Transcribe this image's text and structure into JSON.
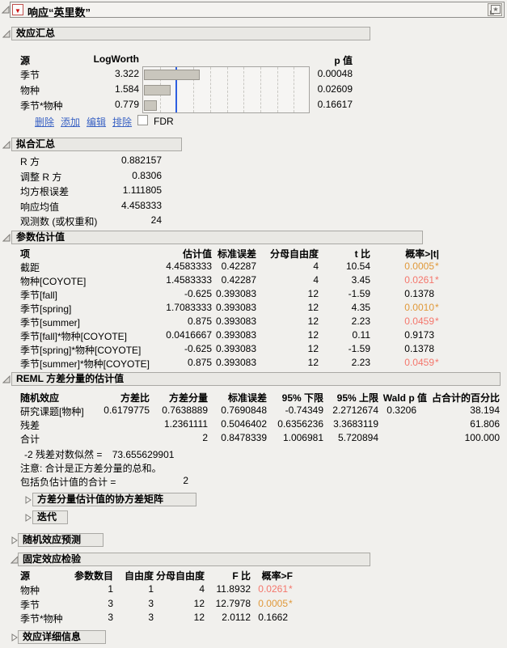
{
  "palette": {
    "sig_orange": "#e0993a",
    "sig_red": "#f4766c",
    "link_blue": "#3b63c4",
    "bar_fill": "#c9c6bd",
    "bar_border": "#9a978f",
    "reference_line_blue": "#2e5fe0",
    "section_header_bg": "#e9e8e4",
    "page_bg": "#f1f0ed"
  },
  "window": {
    "title": "响应“英里数”",
    "red_triangle_icon": "▼",
    "star_icon": "★"
  },
  "sections": {
    "effect_summary": "效应汇总",
    "fit_summary": "拟合汇总",
    "param_estimates": "参数估计值",
    "reml": "REML 方差分量的估计值",
    "cov_matrix": "方差分量估计值的协方差矩阵",
    "iterations": "迭代",
    "random_effect_pred": "随机效应预测",
    "fixed_effect_tests": "固定效应检验",
    "effect_details": "效应详细信息"
  },
  "chart_data": {
    "type": "bar",
    "orientation": "horizontal",
    "title": "效应汇总",
    "col_source": "源",
    "col_logworth": "LogWorth",
    "col_p": "p 值",
    "categories": [
      "季节",
      "物种",
      "季节*物种"
    ],
    "logworth": [
      3.322,
      1.584,
      0.779
    ],
    "logworth_labels": [
      "3.322",
      "1.584",
      "0.779"
    ],
    "p_values": [
      "0.00048",
      "0.02609",
      "0.16617"
    ],
    "xlim": [
      0,
      10
    ],
    "gridline_interval": 1,
    "reference_line": 2,
    "grid": "dashed-vertical"
  },
  "effect_summary": {
    "links": [
      "删除",
      "添加",
      "编辑",
      "排除"
    ],
    "fdr_label": "FDR",
    "fdr_checked": false
  },
  "fit_summary": {
    "rows": [
      [
        "R 方",
        "0.882157"
      ],
      [
        "调整 R 方",
        "0.8306"
      ],
      [
        "均方根误差",
        "1.111805"
      ],
      [
        "响应均值",
        "4.458333"
      ],
      [
        "观测数 (或权重和)",
        "24"
      ]
    ]
  },
  "param_estimates": {
    "columns": [
      "项",
      "估计值",
      "标准误差",
      "分母自由度",
      "t 比",
      "概率>|t|"
    ],
    "rows": [
      [
        "截距",
        "4.4583333",
        "0.42287",
        "4",
        "10.54",
        "0.0005*"
      ],
      [
        "物种[COYOTE]",
        "1.4583333",
        "0.42287",
        "4",
        "3.45",
        "0.0261*"
      ],
      [
        "季节[fall]",
        "-0.625",
        "0.393083",
        "12",
        "-1.59",
        "0.1378"
      ],
      [
        "季节[spring]",
        "1.7083333",
        "0.393083",
        "12",
        "4.35",
        "0.0010*"
      ],
      [
        "季节[summer]",
        "0.875",
        "0.393083",
        "12",
        "2.23",
        "0.0459*"
      ],
      [
        "季节[fall]*物种[COYOTE]",
        "0.0416667",
        "0.393083",
        "12",
        "0.11",
        "0.9173"
      ],
      [
        "季节[spring]*物种[COYOTE]",
        "-0.625",
        "0.393083",
        "12",
        "-1.59",
        "0.1378"
      ],
      [
        "季节[summer]*物种[COYOTE]",
        "0.875",
        "0.393083",
        "12",
        "2.23",
        "0.0459*"
      ]
    ],
    "cell_colors": {
      "0,5": "sig_orange",
      "1,5": "sig_red",
      "3,5": "sig_orange",
      "4,5": "sig_red",
      "7,5": "sig_red"
    }
  },
  "reml": {
    "columns": [
      "随机效应",
      "方差比",
      "方差分量",
      "标准误差",
      "95% 下限",
      "95% 上限",
      "Wald p 值",
      "占合计的百分比"
    ],
    "rows": [
      [
        "研究课题[物种]",
        "0.6179775",
        "0.7638889",
        "0.7690848",
        "-0.74349",
        "2.2712674",
        "0.3206",
        "38.194"
      ],
      [
        "残差",
        "",
        "1.2361111",
        "0.5046402",
        "0.6356236",
        "3.3683119",
        "",
        "61.806"
      ],
      [
        "合计",
        "",
        "2",
        "0.8478339",
        "1.006981",
        "5.720894",
        "",
        "100.000"
      ]
    ],
    "cell_colors": {},
    "neg2loglik_label": "-2 残差对数似然 =",
    "neg2loglik_value": "73.655629901",
    "note": "注意: 合计是正方差分量的总和。",
    "total_incl_label": "包括负估计值的合计 =",
    "total_incl_value": "2"
  },
  "fixed_effect_tests": {
    "columns": [
      "源",
      "参数数目",
      "自由度",
      "分母自由度",
      "F 比",
      "概率>F"
    ],
    "rows": [
      [
        "物种",
        "1",
        "1",
        "4",
        "11.8932",
        "0.0261*"
      ],
      [
        "季节",
        "3",
        "3",
        "12",
        "12.7978",
        "0.0005*"
      ],
      [
        "季节*物种",
        "3",
        "3",
        "12",
        "2.0112",
        "0.1662"
      ]
    ],
    "cell_colors": {
      "0,5": "sig_red",
      "1,5": "sig_orange"
    }
  }
}
